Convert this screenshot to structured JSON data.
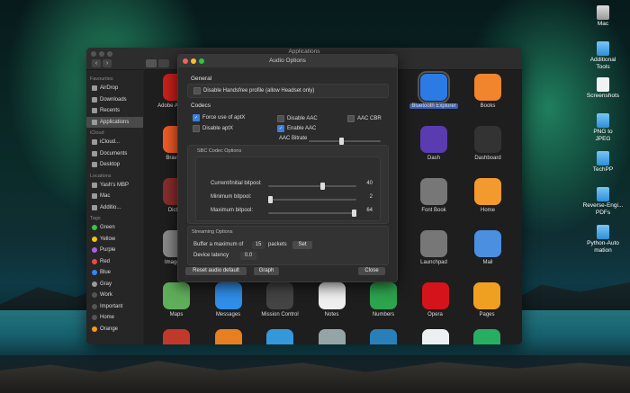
{
  "desktop": {
    "icons": [
      {
        "label": "Mac",
        "icon": "hard-drive-icon"
      },
      {
        "label": "Additional Tools",
        "icon": "folder-icon"
      },
      {
        "label": "Screenshots",
        "icon": "file-icon"
      },
      {
        "label": "PNG to JPEG",
        "icon": "folder-icon"
      },
      {
        "label": "TechPP",
        "icon": "folder-icon"
      },
      {
        "label": "Reverse-Engi...PDFs",
        "icon": "folder-icon"
      },
      {
        "label": "Python-Automation",
        "icon": "folder-icon"
      }
    ]
  },
  "finder": {
    "title": "Applications",
    "nav_back": "‹",
    "nav_forward": "›",
    "sidebar": {
      "favourites_header": "Favourites",
      "favourites": [
        "AirDrop",
        "Downloads",
        "Recents",
        "Applications"
      ],
      "icloud_header": "iCloud",
      "icloud": [
        "iCloud...",
        "Documents",
        "Desktop"
      ],
      "locations_header": "Locations",
      "locations": [
        "Yash's MBP",
        "Mac",
        "Additio..."
      ],
      "tags_header": "Tags",
      "tags": [
        {
          "label": "Green",
          "color": "#3fc14a"
        },
        {
          "label": "Yellow",
          "color": "#f1c40f"
        },
        {
          "label": "Purple",
          "color": "#a560e8"
        },
        {
          "label": "Red",
          "color": "#e74c3c"
        },
        {
          "label": "Blue",
          "color": "#3b82f6"
        },
        {
          "label": "Gray",
          "color": "#9b9b9b"
        },
        {
          "label": "Work",
          "color": "#555555"
        },
        {
          "label": "Important",
          "color": "#555555"
        },
        {
          "label": "Home",
          "color": "#555555"
        },
        {
          "label": "Orange",
          "color": "#f39c12"
        }
      ]
    },
    "apps": [
      {
        "label": "Adobe A Reade",
        "color": "#c8201c"
      },
      {
        "label": "Bluetooth Explorer",
        "color": "#2c7be5"
      },
      {
        "label": "Books",
        "color": "#f0852d"
      },
      {
        "label": "Brave Br",
        "color": "#f05a28"
      },
      {
        "label": "Dash",
        "color": "#5a3bb0"
      },
      {
        "label": "Dashboard",
        "color": "#333333"
      },
      {
        "label": "Diction",
        "color": "#8a2c2c"
      },
      {
        "label": "Font Book",
        "color": "#777777"
      },
      {
        "label": "Home",
        "color": "#f29a2e"
      },
      {
        "label": "Image Ca",
        "color": "#888888"
      },
      {
        "label": "Launchpad",
        "color": "#777777"
      },
      {
        "label": "Mail",
        "color": "#4a8fe0"
      },
      {
        "label": "Maps",
        "color": "#5fae5a"
      },
      {
        "label": "Messages",
        "color": "#2f8ee8"
      },
      {
        "label": "Mission Control",
        "color": "#444444"
      },
      {
        "label": "Notes",
        "color": "#efefef"
      },
      {
        "label": "Numbers",
        "color": "#2da44e"
      },
      {
        "label": "Opera",
        "color": "#d4141a"
      },
      {
        "label": "Pages",
        "color": "#f0a020"
      }
    ]
  },
  "dialog": {
    "title": "Audio Options",
    "general_label": "General",
    "disable_handsfree": "Disable Handsfree profile (allow Headset only)",
    "codecs_label": "Codecs",
    "force_aptx": "Force use of aptX",
    "disable_aac": "Disable AAC",
    "aac_cbr": "AAC CBR",
    "disable_aptx": "Disable aptX",
    "enable_aac": "Enable AAC",
    "aac_bitrate": "AAC Bitrate",
    "aac_bitrate_level": 0.45,
    "sbc_label": "SBC Codec Options",
    "current_bitpool_label": "Current/Initial bitpool:",
    "current_bitpool": "40",
    "current_bitpool_level": 0.62,
    "min_bitpool_label": "Minimum bitpool:",
    "min_bitpool": "2",
    "min_bitpool_level": 0.0,
    "max_bitpool_label": "Maximum bitpool:",
    "max_bitpool": "64",
    "max_bitpool_level": 1.0,
    "streaming_label": "Streaming Options",
    "buffer_prefix": "Buffer a maximum of",
    "buffer_value": "15",
    "buffer_suffix": "packets",
    "set_button": "Set",
    "latency_label": "Device latency",
    "latency_value": "0.0",
    "reset_button": "Reset audio default",
    "graph_button": "Graph",
    "close_button": "Close"
  }
}
